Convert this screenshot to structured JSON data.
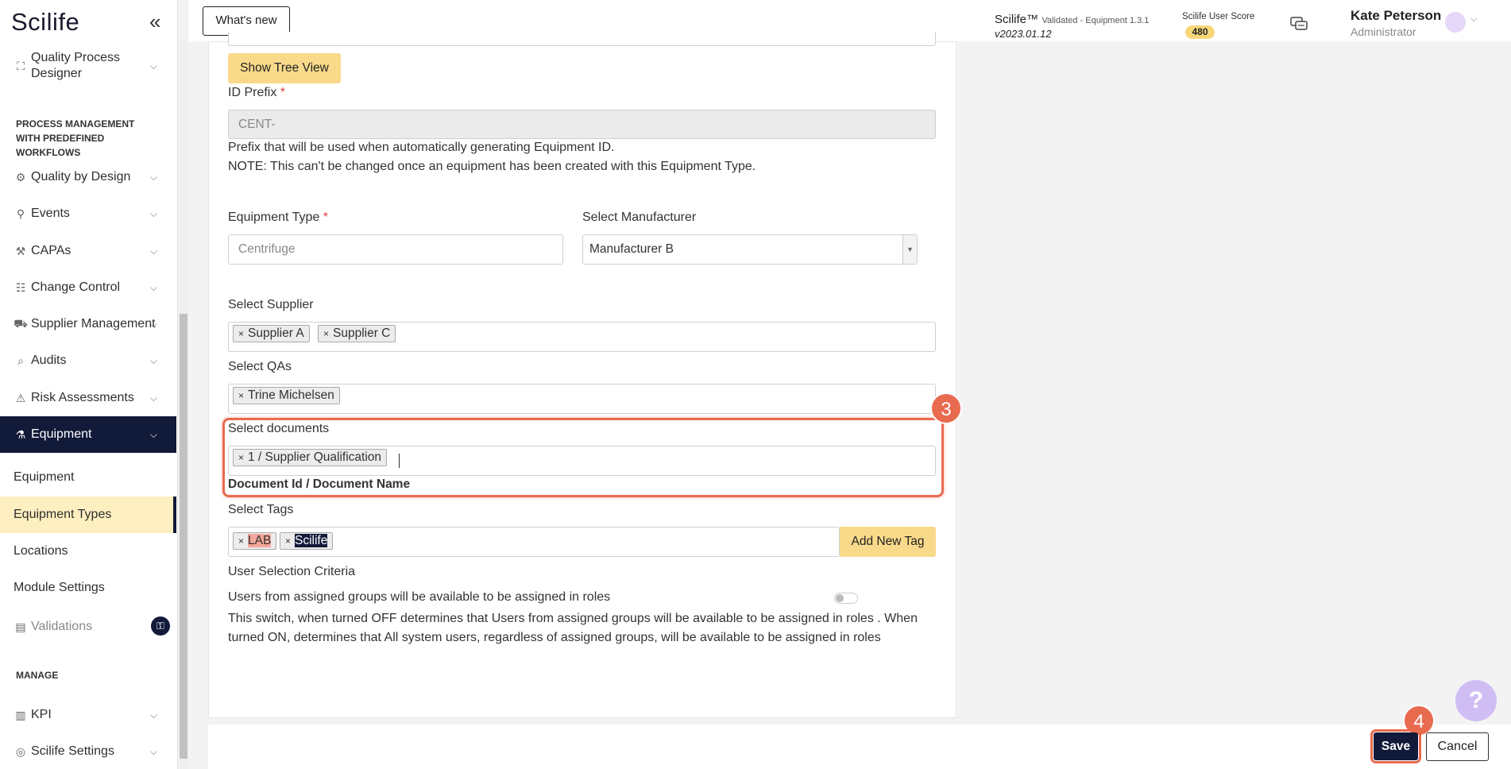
{
  "app": {
    "logo": "Scilife"
  },
  "sidebar": {
    "quality_process_designer": "Quality Process Designer",
    "section_process": "PROCESS MANAGEMENT WITH PREDEFINED WORKFLOWS",
    "items": [
      {
        "label": "Quality by Design"
      },
      {
        "label": "Events"
      },
      {
        "label": "CAPAs"
      },
      {
        "label": "Change Control"
      },
      {
        "label": "Supplier Management"
      },
      {
        "label": "Audits"
      },
      {
        "label": "Risk Assessments"
      },
      {
        "label": "Equipment"
      }
    ],
    "equipment_sub": [
      {
        "label": "Equipment"
      },
      {
        "label": "Equipment Types"
      },
      {
        "label": "Locations"
      },
      {
        "label": "Module Settings"
      },
      {
        "label": "Validations"
      }
    ],
    "section_manage": "MANAGE",
    "manage_items": [
      {
        "label": "KPI"
      },
      {
        "label": "Scilife Settings"
      }
    ]
  },
  "topbar": {
    "whats_new": "What's new",
    "brand": "Scilife™",
    "validated": "Validated - Equipment 1.3.1",
    "version": "v2023.01.12",
    "score_label": "Scilife User Score",
    "score": "480",
    "user_name": "Kate Peterson",
    "user_role": "Administrator"
  },
  "form": {
    "show_tree_view": "Show Tree View",
    "id_prefix_label": "ID Prefix",
    "id_prefix_value": "CENT-",
    "prefix_help": "Prefix that will be used when automatically generating Equipment ID.",
    "prefix_note": "NOTE: This can't be changed once an equipment has been created with this Equipment Type.",
    "equipment_type_label": "Equipment Type",
    "equipment_type_placeholder": "Centrifuge",
    "manufacturer_label": "Select Manufacturer",
    "manufacturer_value": "Manufacturer B",
    "supplier_label": "Select Supplier",
    "suppliers": [
      "Supplier A",
      "Supplier C"
    ],
    "qas_label": "Select QAs",
    "qas": [
      "Trine Michelsen"
    ],
    "documents_label": "Select documents",
    "documents": [
      "1 / Supplier Qualification"
    ],
    "documents_hint": "Document Id / Document Name",
    "tags_label": "Select Tags",
    "tags": [
      "LAB",
      "Scilife"
    ],
    "add_tag": "Add New Tag",
    "user_selection_label": "User Selection Criteria",
    "user_groups_label": "Users from assigned groups will be available to be assigned in roles",
    "switch_help": "This switch, when turned OFF determines that Users from assigned groups will be available to be assigned in roles . When turned ON, determines that All system users, regardless of assigned groups, will be available to be assigned in roles"
  },
  "annotations": {
    "step3": "3",
    "step4": "4"
  },
  "footer": {
    "save": "Save",
    "cancel": "Cancel"
  },
  "help": "?"
}
